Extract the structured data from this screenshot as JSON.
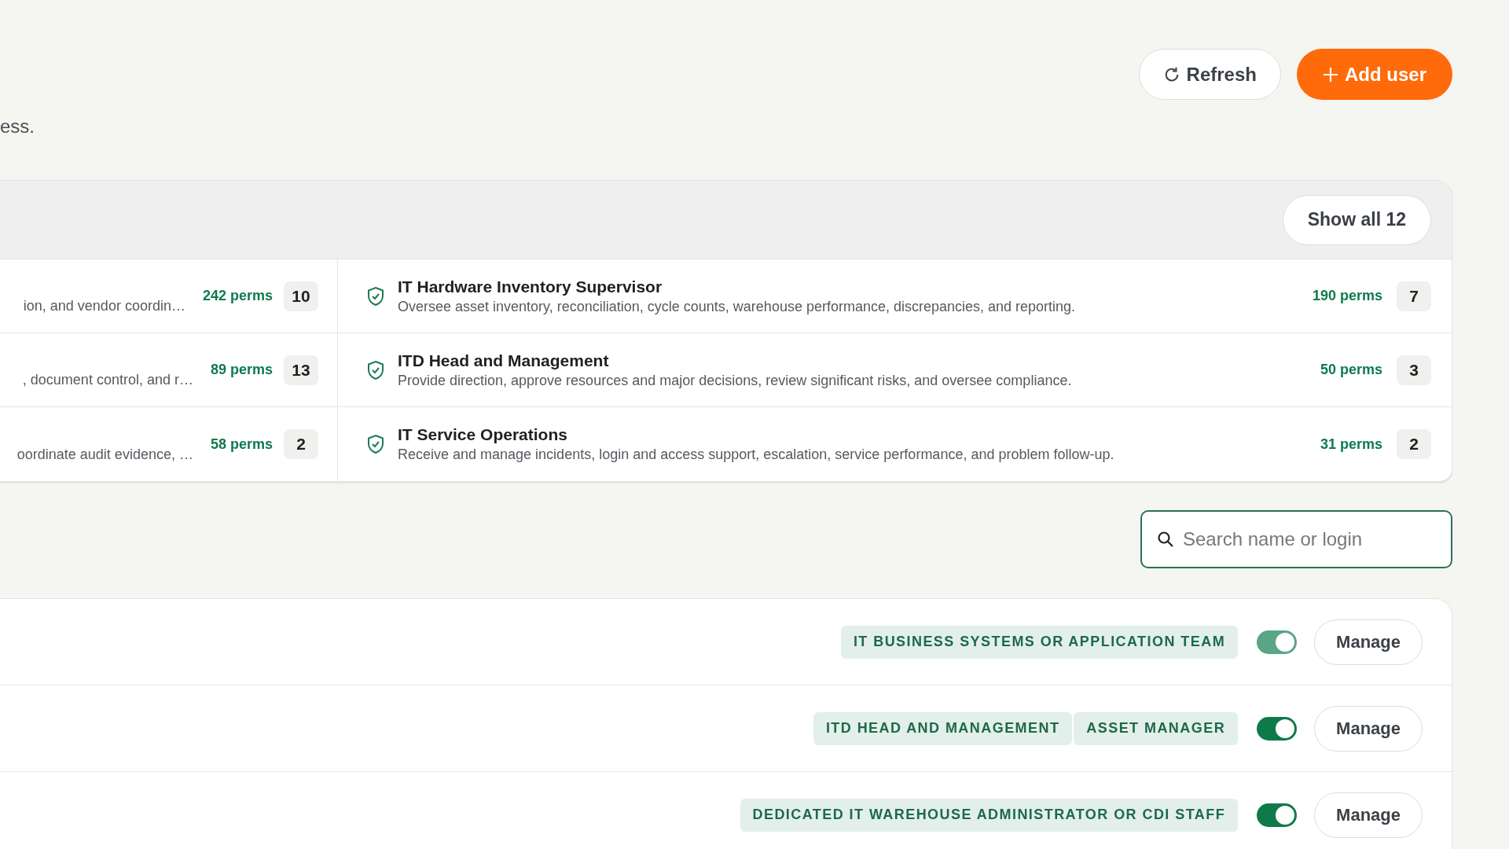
{
  "header": {
    "subtitle_fragment": "ess.",
    "buttons": [
      {
        "kind": "refresh",
        "label": "Refresh"
      },
      {
        "kind": "add",
        "label": "Add user"
      }
    ]
  },
  "roles": {
    "show_all_label": "Show all 12",
    "rows": [
      {
        "left": {
          "description": "ion, and vendor coordin…",
          "perms": "242 perms",
          "count": "10"
        },
        "right": {
          "title": "IT Hardware Inventory Supervisor",
          "description": "Oversee asset inventory, reconciliation, cycle counts, warehouse performance, discrepancies, and reporting.",
          "perms": "190 perms",
          "count": "7"
        }
      },
      {
        "left": {
          "description": ", document control, and r…",
          "perms": "89 perms",
          "count": "13"
        },
        "right": {
          "title": "ITD Head and Management",
          "description": "Provide direction, approve resources and major decisions, review significant risks, and oversee compliance.",
          "perms": "50 perms",
          "count": "3"
        }
      },
      {
        "left": {
          "description": "oordinate audit evidence, …",
          "perms": "58 perms",
          "count": "2"
        },
        "right": {
          "title": "IT Service Operations",
          "description": "Receive and manage incidents, login and access support, escalation, service performance, and problem follow-up.",
          "perms": "31 perms",
          "count": "2"
        }
      }
    ]
  },
  "search": {
    "placeholder": "Search name or login"
  },
  "users": [
    {
      "tags": [
        "IT BUSINESS SYSTEMS OR APPLICATION TEAM"
      ],
      "on": true,
      "disabled": true,
      "action": "Manage"
    },
    {
      "tags": [
        "ITD HEAD AND MANAGEMENT",
        "ASSET MANAGER"
      ],
      "on": true,
      "disabled": false,
      "action": "Manage"
    },
    {
      "tags": [
        "DEDICATED IT WAREHOUSE ADMINISTRATOR OR CDI STAFF"
      ],
      "on": true,
      "disabled": false,
      "action": "Manage"
    }
  ]
}
